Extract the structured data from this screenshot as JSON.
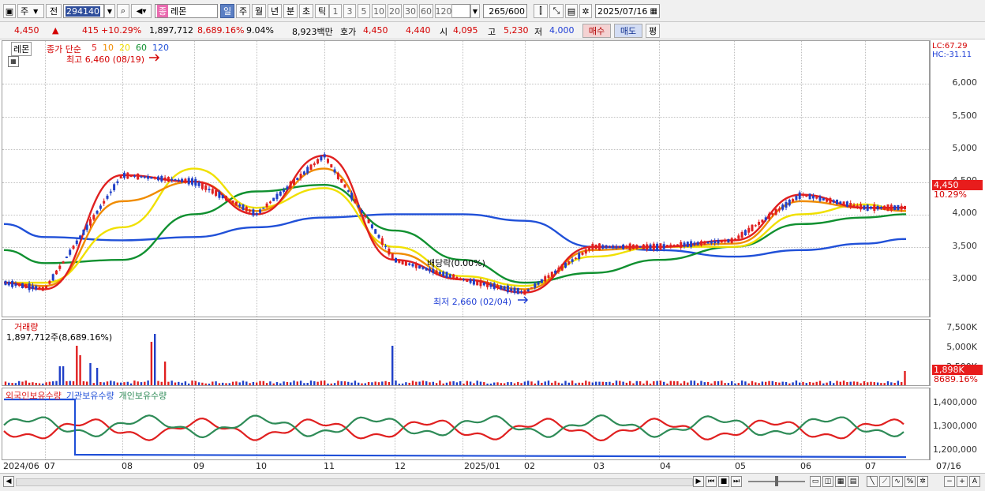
{
  "toolbar": {
    "type_label": "주",
    "prev_label": "전",
    "code_value": "294140",
    "stock_badge": "종",
    "stock_name": "레몬",
    "periods": [
      "일",
      "주",
      "월",
      "년",
      "분",
      "초",
      "틱"
    ],
    "active_period": "일",
    "intervals": [
      "1",
      "3",
      "5",
      "10",
      "20",
      "30",
      "60",
      "120"
    ],
    "count_value": "265",
    "count_max": "/600",
    "date_value": "2025/07/16"
  },
  "quote": {
    "price": "4,450",
    "change_arrow": "▲",
    "change": "415",
    "change_pct": "+10.29%",
    "volume": "1,897,712",
    "volume_ratio": "8,689.16%",
    "turnover": "9.04%",
    "amount": "8,923백만",
    "bid_label": "호가",
    "ask_price": "4,450",
    "bid_price": "4,440",
    "open_label": "시",
    "open": "4,095",
    "high_label": "고",
    "high": "5,230",
    "low_label": "저",
    "low": "4,000",
    "buy_label": "매수",
    "sell_label": "매도",
    "eval_label": "평"
  },
  "price_panel": {
    "stock_tag": "레몬",
    "legend_title": "종가 단순",
    "ma_periods": [
      "5",
      "10",
      "20",
      "60",
      "120"
    ],
    "ma_colors": [
      "#e02020",
      "#f08c00",
      "#f0e000",
      "#109030",
      "#2050d8"
    ],
    "high_annotation": "최고 6,460 (08/19)",
    "low_annotation": "최저 2,660 (02/04)",
    "dividend_annotation": "배당락(0.00%)",
    "lc_label": "LC:67.29",
    "hc_label": "HC:-31.11",
    "current_price_badge": "4,450",
    "current_pct_badge": "10.29%",
    "y_ticks": [
      "6,000",
      "5,500",
      "5,000",
      "4,500",
      "4,000",
      "3,500",
      "3,000"
    ]
  },
  "volume_panel": {
    "title": "거래량",
    "info": "1,897,712주(8,689.16%)",
    "y_ticks": [
      "7,500K",
      "5,000K",
      "2,500K"
    ],
    "badge_value": "1,898K",
    "badge_pct": "8689.16%"
  },
  "holders_panel": {
    "legends": [
      "외국인보유수량",
      "기관보유수량",
      "개인보유수량"
    ],
    "legend_colors": [
      "#e02020",
      "#2050d8",
      "#2e8b57"
    ],
    "y_ticks": [
      "1,400,000",
      "1,300,000",
      "1,200,000"
    ]
  },
  "x_axis": {
    "labels": [
      "2024/06",
      "07",
      "08",
      "09",
      "10",
      "11",
      "12",
      "2025/01",
      "02",
      "03",
      "04",
      "05",
      "06",
      "07"
    ],
    "right_label": "07/16"
  },
  "chart_data": {
    "type": "line",
    "title": "",
    "y_unit": "KRW",
    "ylim": [
      2600,
      6500
    ],
    "x": [
      "2024/06",
      "07",
      "08",
      "09",
      "10",
      "11",
      "12",
      "2025/01",
      "02",
      "03",
      "04",
      "05",
      "06",
      "07",
      "07/16"
    ],
    "series": [
      {
        "name": "5",
        "values": [
          2950,
          2850,
          4600,
          4500,
          4000,
          4900,
          3300,
          3000,
          2800,
          3500,
          3500,
          3600,
          4300,
          4100,
          4100
        ]
      },
      {
        "name": "10",
        "values": [
          2950,
          2900,
          4200,
          4500,
          4050,
          4700,
          3400,
          3000,
          2850,
          3450,
          3500,
          3550,
          4200,
          4100,
          4050
        ]
      },
      {
        "name": "20",
        "values": [
          2950,
          2950,
          3800,
          4700,
          4100,
          4400,
          3500,
          3050,
          2900,
          3350,
          3500,
          3500,
          4000,
          4150,
          4050
        ]
      },
      {
        "name": "60",
        "values": [
          3450,
          3250,
          3300,
          4000,
          4350,
          4450,
          3750,
          3300,
          2950,
          3100,
          3300,
          3500,
          3850,
          3950,
          4000
        ]
      },
      {
        "name": "120",
        "values": [
          3850,
          3650,
          3600,
          3650,
          3800,
          3950,
          4000,
          4000,
          3900,
          3500,
          3450,
          3350,
          3450,
          3550,
          3620
        ]
      }
    ]
  }
}
